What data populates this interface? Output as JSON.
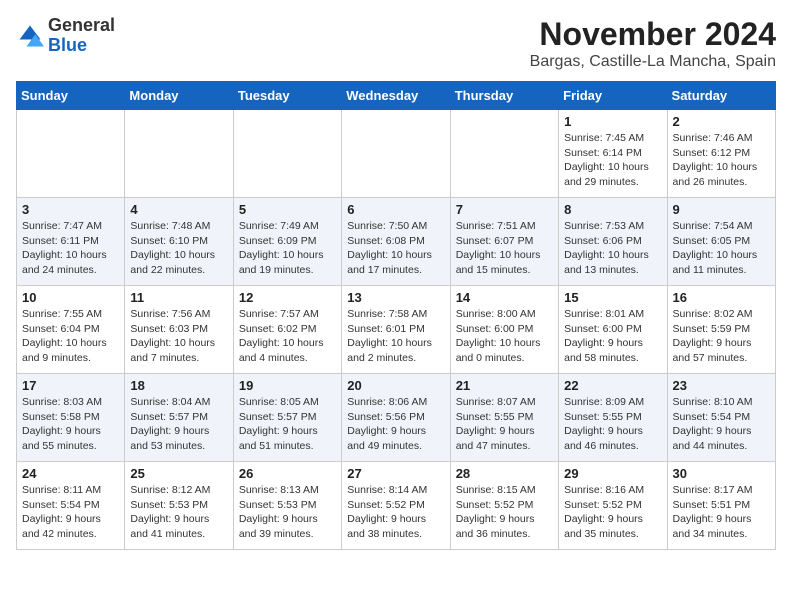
{
  "logo": {
    "general": "General",
    "blue": "Blue"
  },
  "title": "November 2024",
  "location": "Bargas, Castille-La Mancha, Spain",
  "days_of_week": [
    "Sunday",
    "Monday",
    "Tuesday",
    "Wednesday",
    "Thursday",
    "Friday",
    "Saturday"
  ],
  "weeks": [
    [
      {
        "day": "",
        "info": ""
      },
      {
        "day": "",
        "info": ""
      },
      {
        "day": "",
        "info": ""
      },
      {
        "day": "",
        "info": ""
      },
      {
        "day": "",
        "info": ""
      },
      {
        "day": "1",
        "info": "Sunrise: 7:45 AM\nSunset: 6:14 PM\nDaylight: 10 hours and 29 minutes."
      },
      {
        "day": "2",
        "info": "Sunrise: 7:46 AM\nSunset: 6:12 PM\nDaylight: 10 hours and 26 minutes."
      }
    ],
    [
      {
        "day": "3",
        "info": "Sunrise: 7:47 AM\nSunset: 6:11 PM\nDaylight: 10 hours and 24 minutes."
      },
      {
        "day": "4",
        "info": "Sunrise: 7:48 AM\nSunset: 6:10 PM\nDaylight: 10 hours and 22 minutes."
      },
      {
        "day": "5",
        "info": "Sunrise: 7:49 AM\nSunset: 6:09 PM\nDaylight: 10 hours and 19 minutes."
      },
      {
        "day": "6",
        "info": "Sunrise: 7:50 AM\nSunset: 6:08 PM\nDaylight: 10 hours and 17 minutes."
      },
      {
        "day": "7",
        "info": "Sunrise: 7:51 AM\nSunset: 6:07 PM\nDaylight: 10 hours and 15 minutes."
      },
      {
        "day": "8",
        "info": "Sunrise: 7:53 AM\nSunset: 6:06 PM\nDaylight: 10 hours and 13 minutes."
      },
      {
        "day": "9",
        "info": "Sunrise: 7:54 AM\nSunset: 6:05 PM\nDaylight: 10 hours and 11 minutes."
      }
    ],
    [
      {
        "day": "10",
        "info": "Sunrise: 7:55 AM\nSunset: 6:04 PM\nDaylight: 10 hours and 9 minutes."
      },
      {
        "day": "11",
        "info": "Sunrise: 7:56 AM\nSunset: 6:03 PM\nDaylight: 10 hours and 7 minutes."
      },
      {
        "day": "12",
        "info": "Sunrise: 7:57 AM\nSunset: 6:02 PM\nDaylight: 10 hours and 4 minutes."
      },
      {
        "day": "13",
        "info": "Sunrise: 7:58 AM\nSunset: 6:01 PM\nDaylight: 10 hours and 2 minutes."
      },
      {
        "day": "14",
        "info": "Sunrise: 8:00 AM\nSunset: 6:00 PM\nDaylight: 10 hours and 0 minutes."
      },
      {
        "day": "15",
        "info": "Sunrise: 8:01 AM\nSunset: 6:00 PM\nDaylight: 9 hours and 58 minutes."
      },
      {
        "day": "16",
        "info": "Sunrise: 8:02 AM\nSunset: 5:59 PM\nDaylight: 9 hours and 57 minutes."
      }
    ],
    [
      {
        "day": "17",
        "info": "Sunrise: 8:03 AM\nSunset: 5:58 PM\nDaylight: 9 hours and 55 minutes."
      },
      {
        "day": "18",
        "info": "Sunrise: 8:04 AM\nSunset: 5:57 PM\nDaylight: 9 hours and 53 minutes."
      },
      {
        "day": "19",
        "info": "Sunrise: 8:05 AM\nSunset: 5:57 PM\nDaylight: 9 hours and 51 minutes."
      },
      {
        "day": "20",
        "info": "Sunrise: 8:06 AM\nSunset: 5:56 PM\nDaylight: 9 hours and 49 minutes."
      },
      {
        "day": "21",
        "info": "Sunrise: 8:07 AM\nSunset: 5:55 PM\nDaylight: 9 hours and 47 minutes."
      },
      {
        "day": "22",
        "info": "Sunrise: 8:09 AM\nSunset: 5:55 PM\nDaylight: 9 hours and 46 minutes."
      },
      {
        "day": "23",
        "info": "Sunrise: 8:10 AM\nSunset: 5:54 PM\nDaylight: 9 hours and 44 minutes."
      }
    ],
    [
      {
        "day": "24",
        "info": "Sunrise: 8:11 AM\nSunset: 5:54 PM\nDaylight: 9 hours and 42 minutes."
      },
      {
        "day": "25",
        "info": "Sunrise: 8:12 AM\nSunset: 5:53 PM\nDaylight: 9 hours and 41 minutes."
      },
      {
        "day": "26",
        "info": "Sunrise: 8:13 AM\nSunset: 5:53 PM\nDaylight: 9 hours and 39 minutes."
      },
      {
        "day": "27",
        "info": "Sunrise: 8:14 AM\nSunset: 5:52 PM\nDaylight: 9 hours and 38 minutes."
      },
      {
        "day": "28",
        "info": "Sunrise: 8:15 AM\nSunset: 5:52 PM\nDaylight: 9 hours and 36 minutes."
      },
      {
        "day": "29",
        "info": "Sunrise: 8:16 AM\nSunset: 5:52 PM\nDaylight: 9 hours and 35 minutes."
      },
      {
        "day": "30",
        "info": "Sunrise: 8:17 AM\nSunset: 5:51 PM\nDaylight: 9 hours and 34 minutes."
      }
    ]
  ]
}
